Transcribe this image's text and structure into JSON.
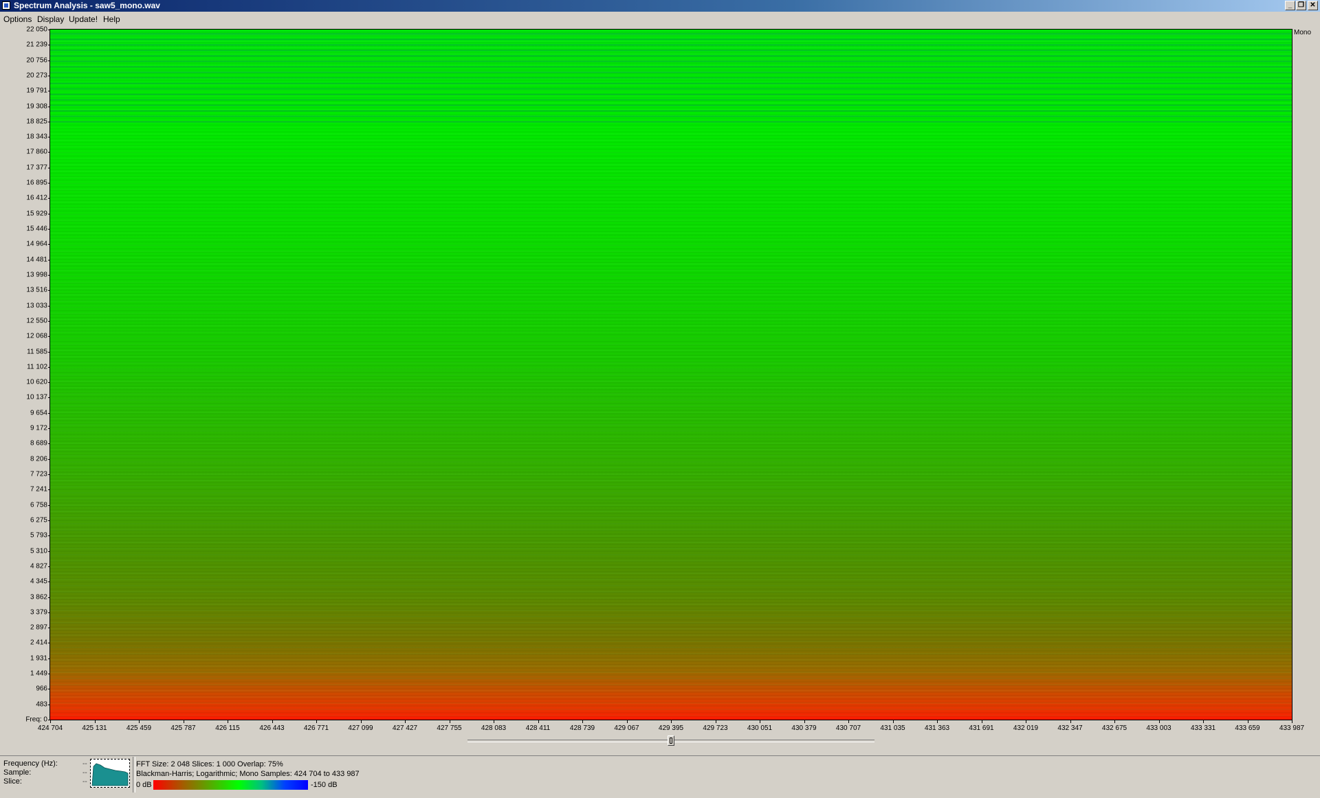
{
  "window": {
    "title": "Spectrum Analysis - saw5_mono.wav",
    "minimize_glyph": "_",
    "maximize_glyph": "❐",
    "close_glyph": "✕"
  },
  "menu": {
    "items": [
      "Options",
      "Display",
      "Update!",
      "Help"
    ]
  },
  "spectrogram": {
    "channel_label": "Mono",
    "y_axis_labels": [
      "22 050",
      "21 239",
      "20 756",
      "20 273",
      "19 791",
      "19 308",
      "18 825",
      "18 343",
      "17 860",
      "17 377",
      "16 895",
      "16 412",
      "15 929",
      "15 446",
      "14 964",
      "14 481",
      "13 998",
      "13 516",
      "13 033",
      "12 550",
      "12 068",
      "11 585",
      "11 102",
      "10 620",
      "10 137",
      "9 654",
      "9 172",
      "8 689",
      "8 206",
      "7 723",
      "7 241",
      "6 758",
      "6 275",
      "5 793",
      "5 310",
      "4 827",
      "4 345",
      "3 862",
      "3 379",
      "2 897",
      "2 414",
      "1 931",
      "1 449",
      "966",
      "483",
      "Freq: 0"
    ],
    "x_axis_labels": [
      "424 704",
      "425 131",
      "425 459",
      "425 787",
      "426 115",
      "426 443",
      "426 771",
      "427 099",
      "427 427",
      "427 755",
      "428 083",
      "428 411",
      "428 739",
      "429 067",
      "429 395",
      "429 723",
      "430 051",
      "430 379",
      "430 707",
      "431 035",
      "431 363",
      "431 691",
      "432 019",
      "432 347",
      "432 675",
      "433 003",
      "433 331",
      "433 659",
      "433 987"
    ],
    "scroll_position": 0.5
  },
  "status": {
    "frequency_label": "Frequency (Hz):",
    "sample_label": "Sample:",
    "slice_label": "Slice:",
    "frequency_value": "--",
    "sample_value": "--",
    "slice_value": "--",
    "info_line1": "FFT Size: 2 048  Slices: 1 000  Overlap: 75%",
    "info_line2": "Blackman-Harris; Logarithmic; Mono  Samples: 424 704 to 433 987",
    "colorbar_min": "0 dB",
    "colorbar_max": "-150 dB"
  },
  "colors": {
    "loud": "#ff0000",
    "mid": "#00ff00",
    "quiet": "#0000ff",
    "mini_spectrum_fill": "#1a9090"
  }
}
